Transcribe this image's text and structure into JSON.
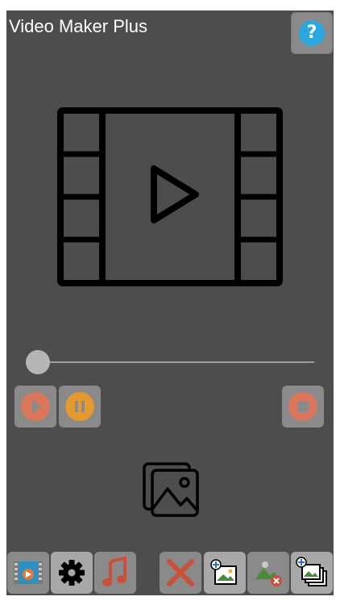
{
  "app": {
    "title": "Video Maker Plus",
    "help_glyph": "?"
  },
  "player": {
    "preview_icon": "film-play-icon",
    "slider_value": 0
  },
  "controls": {
    "play_icon": "play-icon",
    "pause_icon": "pause-icon",
    "stop_icon": "stop-icon"
  },
  "toolbar": {
    "items": [
      "video-strip-icon",
      "gear-icon",
      "music-note-icon",
      "close-icon",
      "add-image-icon",
      "remove-image-icon",
      "add-images-icon"
    ]
  },
  "colors": {
    "background": "#4d4d4d",
    "button": "#8a8a8a",
    "help": "#2aa7dc",
    "play": "#d9765b",
    "pause": "#e59a2f",
    "stop": "#d9765b",
    "close": "#c9503b",
    "music": "#c9503b"
  }
}
